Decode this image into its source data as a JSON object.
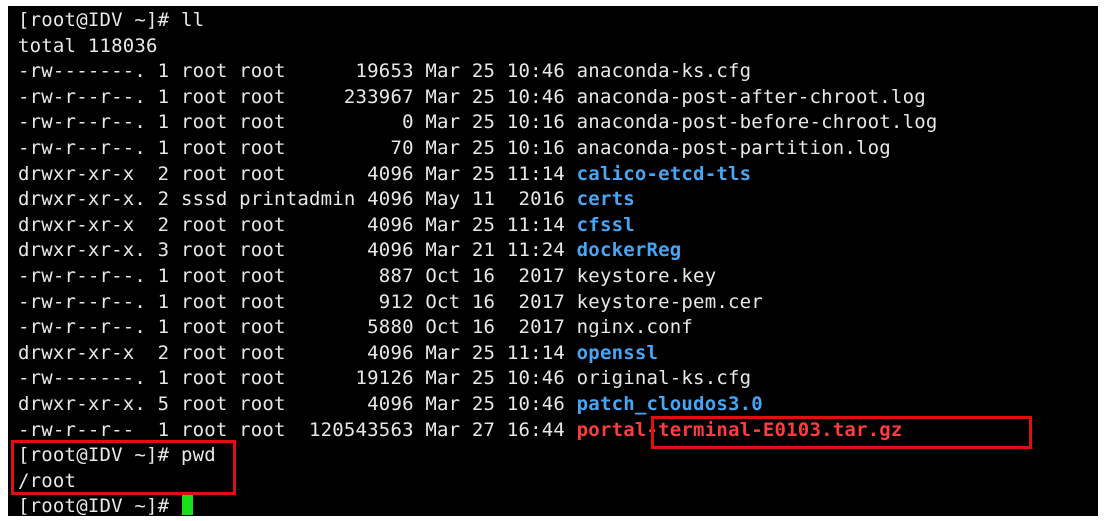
{
  "terminal": {
    "lines": [
      {
        "text": "[root@IDV ~]# ll"
      },
      {
        "text": "total 118036"
      },
      {
        "text": "-rw-------. 1 root root      19653 Mar 25 10:46 ",
        "name": "anaconda-ks.cfg",
        "type": "file"
      },
      {
        "text": "-rw-r--r--. 1 root root     233967 Mar 25 10:46 ",
        "name": "anaconda-post-after-chroot.log",
        "type": "file"
      },
      {
        "text": "-rw-r--r--. 1 root root          0 Mar 25 10:16 ",
        "name": "anaconda-post-before-chroot.log",
        "type": "file"
      },
      {
        "text": "-rw-r--r--. 1 root root         70 Mar 25 10:16 ",
        "name": "anaconda-post-partition.log",
        "type": "file"
      },
      {
        "text": "drwxr-xr-x  2 root root       4096 Mar 25 11:14 ",
        "name": "calico-etcd-tls",
        "type": "dir"
      },
      {
        "text": "drwxr-xr-x. 2 sssd printadmin 4096 May 11  2016 ",
        "name": "certs",
        "type": "dir"
      },
      {
        "text": "drwxr-xr-x  2 root root       4096 Mar 25 11:14 ",
        "name": "cfssl",
        "type": "dir"
      },
      {
        "text": "drwxr-xr-x. 3 root root       4096 Mar 21 11:24 ",
        "name": "dockerReg",
        "type": "dir"
      },
      {
        "text": "-rw-r--r--. 1 root root        887 Oct 16  2017 ",
        "name": "keystore.key",
        "type": "file"
      },
      {
        "text": "-rw-r--r--. 1 root root        912 Oct 16  2017 ",
        "name": "keystore-pem.cer",
        "type": "file"
      },
      {
        "text": "-rw-r--r--. 1 root root       5880 Oct 16  2017 ",
        "name": "nginx.conf",
        "type": "file"
      },
      {
        "text": "drwxr-xr-x  2 root root       4096 Mar 25 11:14 ",
        "name": "openssl",
        "type": "dir"
      },
      {
        "text": "-rw-------. 1 root root      19126 Mar 25 10:46 ",
        "name": "original-ks.cfg",
        "type": "file"
      },
      {
        "text": "drwxr-xr-x. 5 root root       4096 Mar 25 10:46 ",
        "name": "patch_cloudos3.0",
        "type": "dir"
      },
      {
        "text": "-rw-r--r--  1 root root  120543563 Mar 27 16:44 ",
        "name": "portal-terminal-E0103.tar.gz",
        "type": "archive"
      },
      {
        "text": "[root@IDV ~]# pwd"
      },
      {
        "text": "/root"
      },
      {
        "text": "[root@IDV ~]# "
      }
    ],
    "colors": {
      "background": "#000000",
      "text": "#e8e8e8",
      "directory": "#46a6f5",
      "archive": "#ff3b3b",
      "cursor": "#18e018",
      "highlight_box": "#e01010"
    }
  }
}
